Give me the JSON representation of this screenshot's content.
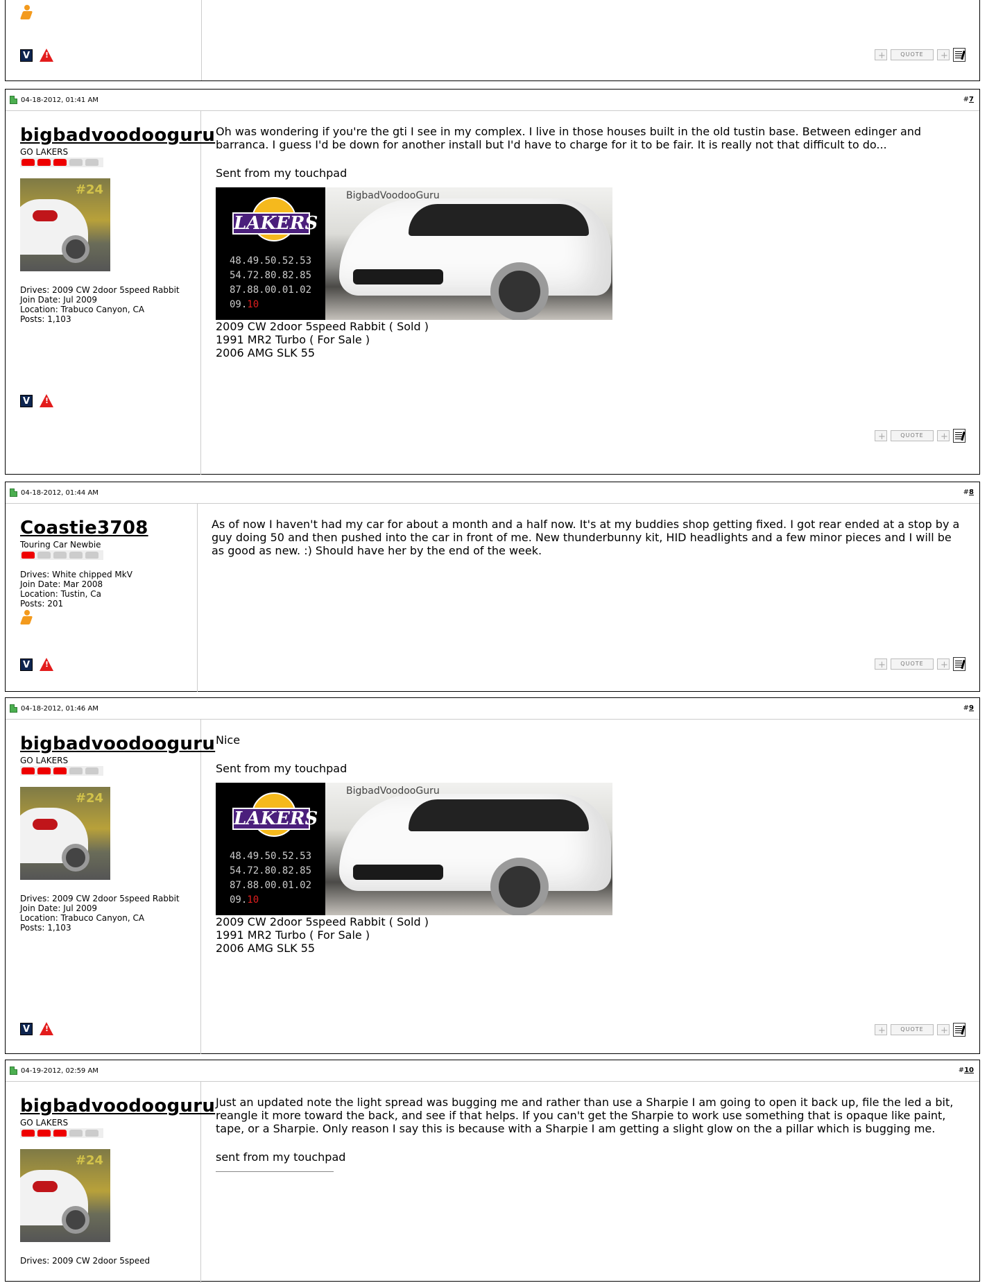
{
  "labels": {
    "quote": "QUOTE",
    "drives_prefix": "Drives: ",
    "join_prefix": "Join Date: ",
    "location_prefix": "Location: ",
    "posts_prefix": "Posts: ",
    "hash": "#"
  },
  "signature": {
    "banner_text": "BigbadVoodooGuru",
    "logo_text": "LAKERS",
    "numbers": [
      "48.49.50.52.53",
      "54.72.80.82.85",
      "87.88.00.01.02"
    ],
    "numbers_last": "09.",
    "numbers_last_red": "10",
    "lines": [
      "2009 CW 2door 5speed Rabbit ( Sold )",
      "1991 MR2 Turbo ( For Sale )",
      "2006 AMG SLK 55"
    ]
  },
  "posts": [
    {
      "date": "04-18-2012, 01:41 AM",
      "number": "7",
      "username": "bigbadvoodooguru",
      "user_title": "GO LAKERS",
      "rep": 3,
      "drives": "2009 CW 2door 5speed Rabbit",
      "join_date": "Jul 2009",
      "location": "Trabuco Canyon, CA",
      "posts": "1,103",
      "text": "Oh was wondering if you're the gti I see in my complex. I live in those houses built in the old tustin base. Between edinger and barranca. I guess I'd be down for another install but I'd have to charge for it to be fair. It is really not that difficult to do...",
      "sent": "Sent from my touchpad"
    },
    {
      "date": "04-18-2012, 01:44 AM",
      "number": "8",
      "username": "Coastie3708",
      "user_title": "Touring Car Newbie",
      "rep": 1,
      "drives": "White chipped MkV",
      "join_date": "Mar 2008",
      "location": "Tustin, Ca",
      "posts": "201",
      "text": "As of now I haven't had my car for about a month and a half now. It's at my buddies shop getting fixed. I got rear ended at a stop by a guy doing 50 and then pushed into the car in front of me. New thunderbunny kit, HID headlights and a few minor pieces and I will be as good as new. :) Should have her by the end of the week."
    },
    {
      "date": "04-18-2012, 01:46 AM",
      "number": "9",
      "username": "bigbadvoodooguru",
      "user_title": "GO LAKERS",
      "rep": 3,
      "drives": "2009 CW 2door 5speed Rabbit",
      "join_date": "Jul 2009",
      "location": "Trabuco Canyon, CA",
      "posts": "1,103",
      "text": "Nice",
      "sent": "Sent from my touchpad"
    },
    {
      "date": "04-19-2012, 02:59 AM",
      "number": "10",
      "username": "bigbadvoodooguru",
      "user_title": "GO LAKERS",
      "rep": 3,
      "drives": "2009 CW 2door 5speed",
      "text": "Just an updated note the light spread was bugging me and rather than use a Sharpie I am going to open it back up, file the led a bit, reangle it more toward the back, and see if that helps. If you can't get the Sharpie to work use something that is opaque like paint, tape, or a Sharpie. Only reason I say this is because with a Sharpie I am getting a slight glow on the a pillar which is bugging me.",
      "sent": "sent from my touchpad"
    }
  ]
}
